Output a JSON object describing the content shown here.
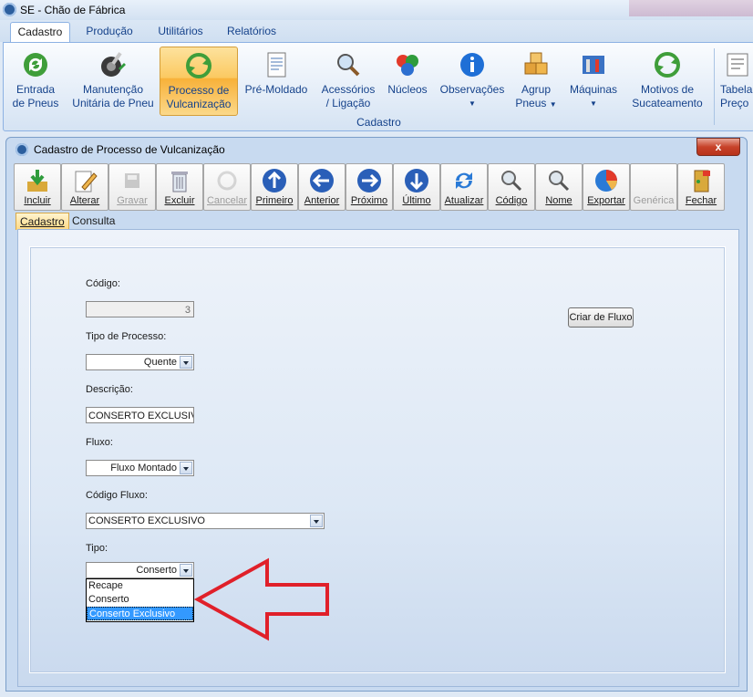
{
  "app": {
    "title": "SE - Chão de Fábrica"
  },
  "ribbon_tabs": [
    {
      "label": "Cadastro",
      "active": true
    },
    {
      "label": "Produção"
    },
    {
      "label": "Utilitários"
    },
    {
      "label": "Relatórios"
    }
  ],
  "ribbon": {
    "group_label": "Cadastro",
    "buttons": [
      {
        "label": "Entrada\nde Pneus",
        "icon": "recycle-green-icon"
      },
      {
        "label": "Manutenção\nUnitária de Pneu",
        "icon": "tire-repair-icon"
      },
      {
        "label": "Processo de\nVulcanização",
        "icon": "recycle-process-icon",
        "selected": true
      },
      {
        "label": "Pré-Moldado",
        "icon": "document-icon"
      },
      {
        "label": "Acessórios\n/ Ligação",
        "icon": "magnifier-connection-icon"
      },
      {
        "label": "Núcleos",
        "icon": "color-balls-icon"
      },
      {
        "label": "Observações",
        "icon": "info-icon",
        "dropdown": true
      },
      {
        "label": "Agrup\nPneus",
        "icon": "boxes-icon",
        "dropdown": true
      },
      {
        "label": "Máquinas",
        "icon": "tools-icon",
        "dropdown": true
      },
      {
        "label": "Motivos de\nSucateamento",
        "icon": "recycle-scrap-icon"
      },
      {
        "label": "Tabela\nPreço",
        "icon": "price-table-icon"
      }
    ]
  },
  "window": {
    "title": "Cadastro de Processo de Vulcanização",
    "close_label": "x"
  },
  "toolbar": [
    {
      "label": "Incluir",
      "icon": "add-down-arrow-icon",
      "enabled": true
    },
    {
      "label": "Alterar",
      "icon": "pencil-icon",
      "enabled": true
    },
    {
      "label": "Gravar",
      "icon": "save-icon",
      "enabled": false
    },
    {
      "label": "Excluir",
      "icon": "trash-icon",
      "enabled": true
    },
    {
      "label": "Cancelar",
      "icon": "cancel-icon",
      "enabled": false
    },
    {
      "label": "Primeiro",
      "icon": "arrow-up-icon",
      "enabled": true
    },
    {
      "label": "Anterior",
      "icon": "arrow-left-icon",
      "enabled": true
    },
    {
      "label": "Próximo",
      "icon": "arrow-right-icon",
      "enabled": true
    },
    {
      "label": "Último",
      "icon": "arrow-down-icon",
      "enabled": true
    },
    {
      "label": "Atualizar",
      "icon": "refresh-icon",
      "enabled": true
    },
    {
      "label": "Código",
      "icon": "search-code-icon",
      "enabled": true
    },
    {
      "label": "Nome",
      "icon": "search-name-icon",
      "enabled": true
    },
    {
      "label": "Exportar",
      "icon": "pie-chart-icon",
      "enabled": true
    },
    {
      "label": "Genérica",
      "icon": "generic-icon",
      "enabled": false
    },
    {
      "label": "Fechar",
      "icon": "exit-door-icon",
      "enabled": true
    }
  ],
  "inner_tabs": [
    {
      "label": "Cadastro",
      "active": true
    },
    {
      "label": "Consulta"
    }
  ],
  "form": {
    "codigo_label": "Código:",
    "codigo_value": "3",
    "tipo_processo_label": "Tipo de Processo:",
    "tipo_processo_value": "Quente",
    "descricao_label": "Descrição:",
    "descricao_value": "CONSERTO EXCLUSIVO",
    "fluxo_label": "Fluxo:",
    "fluxo_value": "Fluxo Montado",
    "codigo_fluxo_label": "Código Fluxo:",
    "codigo_fluxo_value": "CONSERTO EXCLUSIVO",
    "tipo_label": "Tipo:",
    "tipo_value": "Conserto",
    "tipo_options": [
      "Recape",
      "Conserto",
      "Conserto Exclusivo"
    ],
    "tipo_highlighted": "Conserto Exclusivo",
    "criar_fluxo_label": "Criar de Fluxo"
  },
  "colors": {
    "ribbon_selected": "#fbc961",
    "annotation_arrow": "#e0202a",
    "list_highlight": "#3399ff"
  }
}
